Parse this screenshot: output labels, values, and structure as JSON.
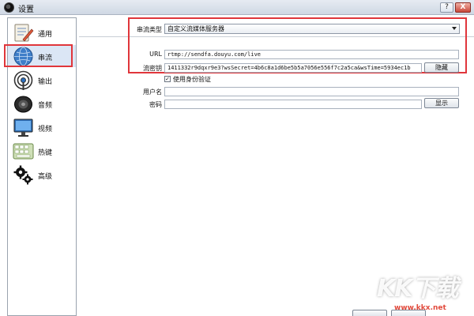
{
  "window": {
    "title": "设置",
    "help_glyph": "?",
    "close_glyph": "X"
  },
  "sidebar": {
    "items": [
      {
        "label": "通用",
        "icon": "general-icon"
      },
      {
        "label": "串流",
        "icon": "stream-globe-icon"
      },
      {
        "label": "输出",
        "icon": "output-broadcast-icon"
      },
      {
        "label": "音频",
        "icon": "speaker-icon"
      },
      {
        "label": "视频",
        "icon": "monitor-icon"
      },
      {
        "label": "热键",
        "icon": "keyboard-icon"
      },
      {
        "label": "高级",
        "icon": "gears-icon"
      }
    ],
    "selected_index": 1
  },
  "stream": {
    "type_label": "串流类型",
    "type_value": "自定义流媒体服务器",
    "url_label": "URL",
    "url_value": "rtmp://sendfa.douyu.com/live",
    "key_label": "流密钥",
    "key_value": "1411332r9dqxr9e3?wsSecret=4b6c8a1d6be5b5a7056e556f7c2a5ca&wsTime=5934ec1b",
    "hide_button": "隐藏",
    "use_auth_label": "使用身份验证",
    "use_auth_checked": true,
    "username_label": "用户名",
    "username_value": "",
    "password_label": "密码",
    "password_value": "",
    "show_button": "显示"
  },
  "colors": {
    "highlight_red": "#e0363b",
    "sidebar_selected": "#dbe6f5"
  },
  "watermark": {
    "logo": "KK下载",
    "url": "www.kkx.net"
  }
}
